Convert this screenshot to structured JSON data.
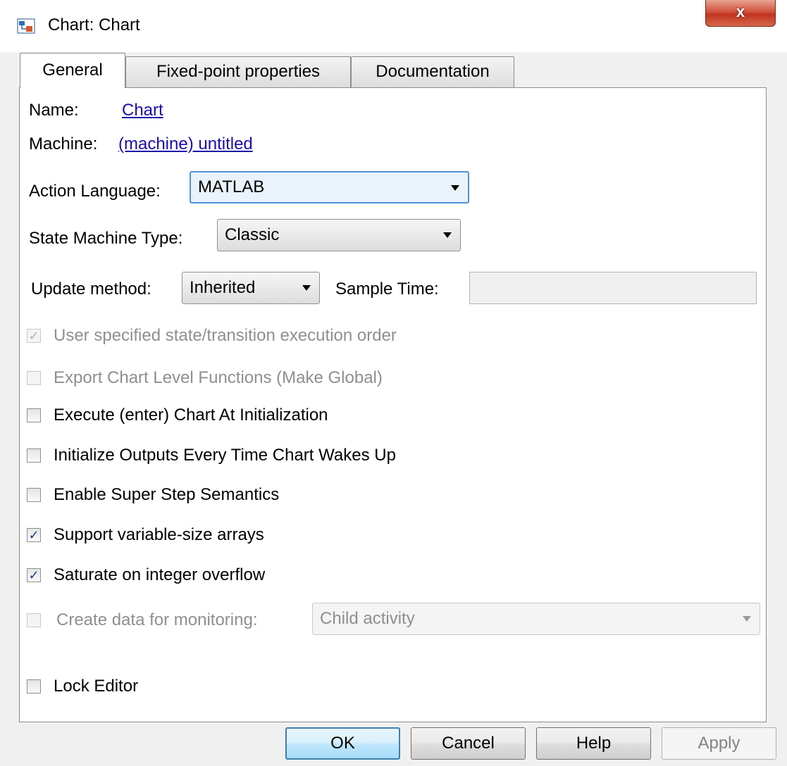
{
  "window": {
    "title": "Chart: Chart",
    "close_label": "x"
  },
  "tabs": [
    {
      "label": "General",
      "active": true
    },
    {
      "label": "Fixed-point properties",
      "active": false
    },
    {
      "label": "Documentation",
      "active": false
    }
  ],
  "general": {
    "name_label": "Name:",
    "name_value": "Chart",
    "machine_label": "Machine:",
    "machine_value": "(machine) untitled",
    "action_language_label": "Action Language:",
    "action_language_value": "MATLAB",
    "state_machine_type_label": "State Machine Type:",
    "state_machine_type_value": "Classic",
    "update_method_label": "Update method:",
    "update_method_value": "Inherited",
    "sample_time_label": "Sample Time:",
    "sample_time_value": "",
    "checkboxes": [
      {
        "label": "User specified state/transition execution order",
        "checked": true,
        "enabled": false
      },
      {
        "label": "Export Chart Level Functions (Make Global)",
        "checked": false,
        "enabled": false
      },
      {
        "label": "Execute (enter) Chart At Initialization",
        "checked": false,
        "enabled": true
      },
      {
        "label": "Initialize Outputs Every Time Chart Wakes Up",
        "checked": false,
        "enabled": true
      },
      {
        "label": "Enable Super Step Semantics",
        "checked": false,
        "enabled": true
      },
      {
        "label": "Support variable-size arrays",
        "checked": true,
        "enabled": true
      },
      {
        "label": "Saturate on integer overflow",
        "checked": true,
        "enabled": true
      },
      {
        "label": "Create data for monitoring:",
        "checked": false,
        "enabled": false
      },
      {
        "label": "Lock Editor",
        "checked": false,
        "enabled": true
      }
    ],
    "monitoring_value": "Child activity"
  },
  "buttons": {
    "ok": "OK",
    "cancel": "Cancel",
    "help": "Help",
    "apply": "Apply"
  },
  "colors": {
    "link": "#1a0dab",
    "disabled_text": "#8f8f8f",
    "focus_border": "#4b93d8"
  },
  "check_mark": "✓"
}
